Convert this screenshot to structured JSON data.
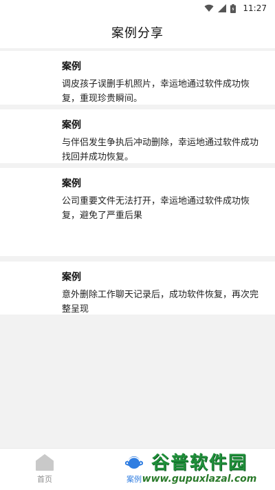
{
  "status_bar": {
    "time": "11:27",
    "icons": [
      "wifi-icon",
      "signal-icon",
      "battery-icon"
    ]
  },
  "header": {
    "title": "案例分享"
  },
  "cases": [
    {
      "title": "案例",
      "body": "调皮孩子误删手机照片，幸运地通过软件成功恢复，重现珍贵瞬间。"
    },
    {
      "title": "案例",
      "body": "与伴侣发生争执后冲动删除，幸运地通过软件成功找回并成功恢复。"
    },
    {
      "title": "案例",
      "body": "公司重要文件无法打开，幸运地通过软件成功恢复，避免了严重后果"
    },
    {
      "title": "案例",
      "body": "意外删除工作聊天记录后，成功软件恢复，再次完整呈现"
    }
  ],
  "bottom_nav": {
    "items": [
      {
        "label": "首页",
        "icon": "home-icon",
        "active": false
      },
      {
        "label": "案例",
        "icon": "planet-icon",
        "active": true
      }
    ]
  },
  "watermark": {
    "logo": "谷普软件园",
    "url": "www.gupuxlazal.com"
  },
  "colors": {
    "accent": "#2f7de1",
    "background": "#f2f2f2",
    "watermark": "#1f8f3a"
  }
}
